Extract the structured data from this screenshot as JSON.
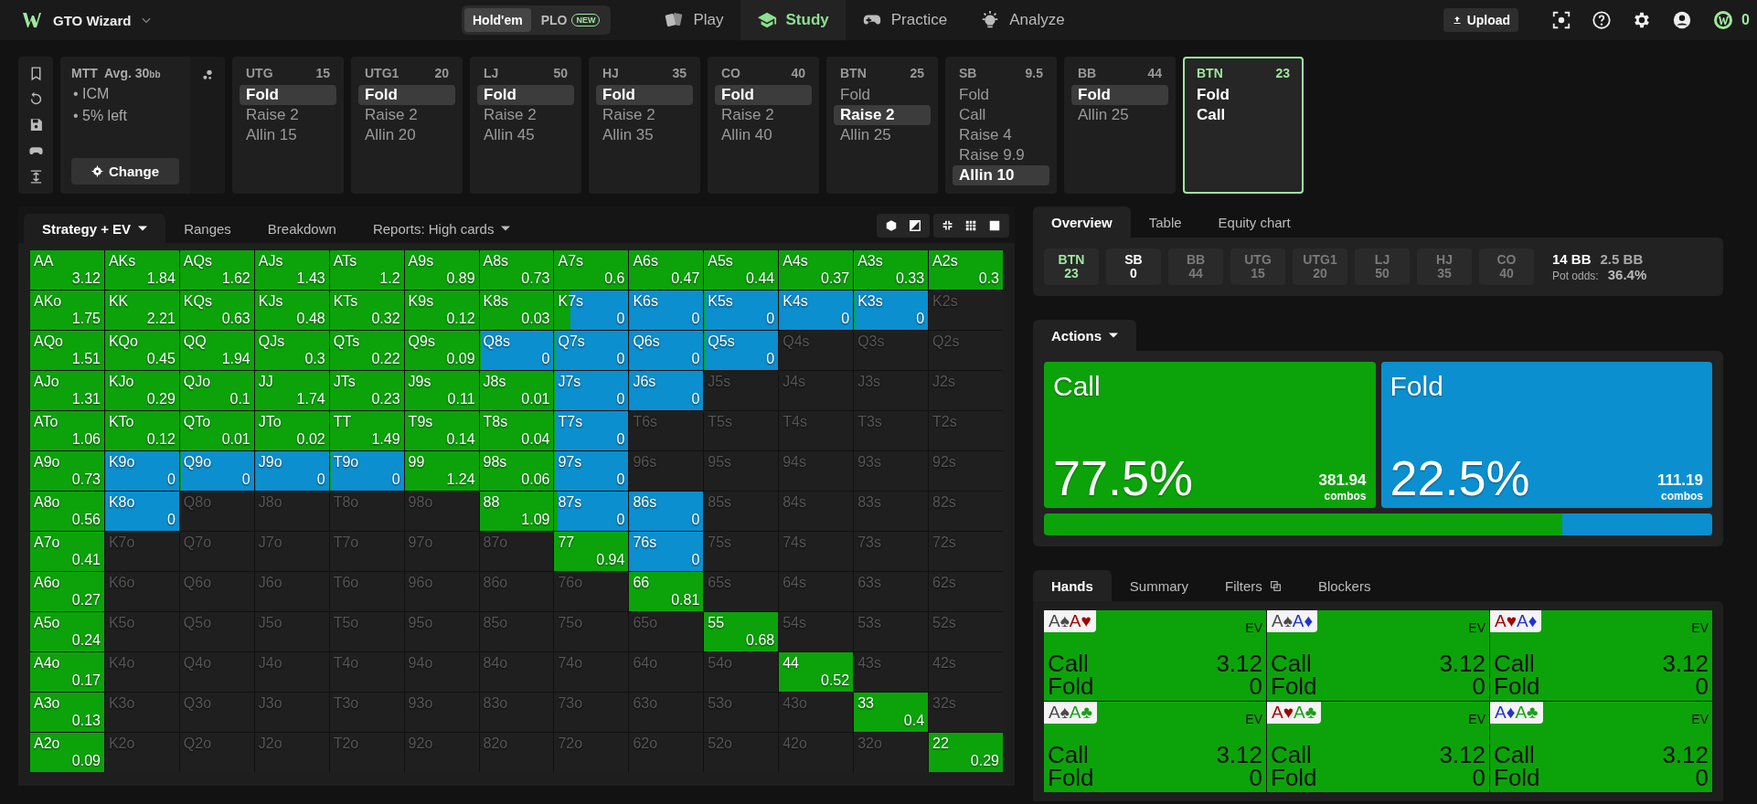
{
  "topbar": {
    "brand": "GTO Wizard",
    "game_toggle": [
      {
        "label": "Hold'em",
        "selected": true
      },
      {
        "label": "PLO",
        "badge": "NEW",
        "selected": false
      }
    ],
    "nav": [
      {
        "label": "Play",
        "selected": false
      },
      {
        "label": "Study",
        "selected": true
      },
      {
        "label": "Practice",
        "selected": false
      },
      {
        "label": "Analyze",
        "selected": false
      }
    ],
    "upload": "Upload",
    "coins": "0"
  },
  "spot": {
    "format": "MTT",
    "avg": "Avg. 30",
    "avg_unit": "bb",
    "notes": [
      "• ICM",
      "• 5% left"
    ],
    "change": "Change"
  },
  "positions": [
    {
      "position": "UTG",
      "stack": "15",
      "current": false,
      "actions": [
        {
          "label": "Fold",
          "selected": true
        },
        {
          "label": "Raise 2",
          "selected": false
        },
        {
          "label": "Allin 15",
          "selected": false
        }
      ]
    },
    {
      "position": "UTG1",
      "stack": "20",
      "current": false,
      "actions": [
        {
          "label": "Fold",
          "selected": true
        },
        {
          "label": "Raise 2",
          "selected": false
        },
        {
          "label": "Allin 20",
          "selected": false
        }
      ]
    },
    {
      "position": "LJ",
      "stack": "50",
      "current": false,
      "actions": [
        {
          "label": "Fold",
          "selected": true
        },
        {
          "label": "Raise 2",
          "selected": false
        },
        {
          "label": "Allin 45",
          "selected": false
        }
      ]
    },
    {
      "position": "HJ",
      "stack": "35",
      "current": false,
      "actions": [
        {
          "label": "Fold",
          "selected": true
        },
        {
          "label": "Raise 2",
          "selected": false
        },
        {
          "label": "Allin 35",
          "selected": false
        }
      ]
    },
    {
      "position": "CO",
      "stack": "40",
      "current": false,
      "actions": [
        {
          "label": "Fold",
          "selected": true
        },
        {
          "label": "Raise 2",
          "selected": false
        },
        {
          "label": "Allin 40",
          "selected": false
        }
      ]
    },
    {
      "position": "BTN",
      "stack": "25",
      "current": false,
      "actions": [
        {
          "label": "Fold",
          "selected": false
        },
        {
          "label": "Raise 2",
          "selected": true
        },
        {
          "label": "Allin 25",
          "selected": false
        }
      ]
    },
    {
      "position": "SB",
      "stack": "9.5",
      "current": false,
      "actions": [
        {
          "label": "Fold",
          "selected": false
        },
        {
          "label": "Call",
          "selected": false
        },
        {
          "label": "Raise 4",
          "selected": false
        },
        {
          "label": "Raise 9.9",
          "selected": false
        },
        {
          "label": "Allin 10",
          "selected": true
        }
      ]
    },
    {
      "position": "BB",
      "stack": "44",
      "current": false,
      "actions": [
        {
          "label": "Fold",
          "selected": true
        },
        {
          "label": "Allin 25",
          "selected": false
        }
      ]
    },
    {
      "position": "BTN",
      "stack": "23",
      "current": true,
      "actions": [
        {
          "label": "Fold",
          "selected": false
        },
        {
          "label": "Call",
          "selected": false
        }
      ]
    }
  ],
  "matrix_tabs": [
    {
      "label": "Strategy + EV",
      "selected": true,
      "dropdown": true
    },
    {
      "label": "Ranges",
      "selected": false,
      "dropdown": false
    },
    {
      "label": "Breakdown",
      "selected": false,
      "dropdown": false
    },
    {
      "label": "Reports: High cards",
      "selected": false,
      "dropdown": true
    }
  ],
  "matrix": {
    "rows": [
      {
        "cells": [
          {
            "hand": "AA",
            "ev": "3.12",
            "call": {
              "level": 1
            }
          },
          {
            "hand": "AKs",
            "ev": "1.84",
            "call": {
              "level": 1
            }
          },
          {
            "hand": "AQs",
            "ev": "1.62",
            "call": {
              "level": 1
            }
          },
          {
            "hand": "AJs",
            "ev": "1.43",
            "call": {
              "level": 1
            }
          },
          {
            "hand": "ATs",
            "ev": "1.2",
            "call": {
              "level": 1
            }
          },
          {
            "hand": "A9s",
            "ev": "0.89",
            "call": {
              "level": 1
            }
          },
          {
            "hand": "A8s",
            "ev": "0.73",
            "call": {
              "level": 1
            }
          },
          {
            "hand": "A7s",
            "ev": "0.6",
            "call": {
              "level": 1
            }
          },
          {
            "hand": "A6s",
            "ev": "0.47",
            "call": {
              "level": 1
            }
          },
          {
            "hand": "A5s",
            "ev": "0.44",
            "call": {
              "level": 1
            }
          },
          {
            "hand": "A4s",
            "ev": "0.37",
            "call": {
              "level": 1
            }
          },
          {
            "hand": "A3s",
            "ev": "0.33",
            "call": {
              "level": 1
            }
          },
          {
            "hand": "A2s",
            "ev": "0.3",
            "call": {
              "level": 1
            }
          }
        ]
      },
      {
        "cells": [
          {
            "hand": "AKo",
            "ev": "1.75",
            "call": {
              "level": 1
            }
          },
          {
            "hand": "KK",
            "ev": "2.21",
            "call": {
              "level": 1
            }
          },
          {
            "hand": "KQs",
            "ev": "0.63",
            "call": {
              "level": 1
            }
          },
          {
            "hand": "KJs",
            "ev": "0.48",
            "call": {
              "level": 1
            }
          },
          {
            "hand": "KTs",
            "ev": "0.32",
            "call": {
              "level": 1
            }
          },
          {
            "hand": "K9s",
            "ev": "0.12",
            "call": {
              "level": 1
            }
          },
          {
            "hand": "K8s",
            "ev": "0.03",
            "call": {
              "level": 1
            }
          },
          {
            "hand": "K7s",
            "ev": "0",
            "call": {
              "level": 0.22
            }
          },
          {
            "hand": "K6s",
            "ev": "0",
            "call": {
              "level": 0
            }
          },
          {
            "hand": "K5s",
            "ev": "0",
            "call": {
              "level": 0
            }
          },
          {
            "hand": "K4s",
            "ev": "0",
            "call": {
              "level": 0
            }
          },
          {
            "hand": "K3s",
            "ev": "0",
            "call": {
              "level": 0
            }
          },
          {
            "hand": "K2s"
          }
        ]
      },
      {
        "cells": [
          {
            "hand": "AQo",
            "ev": "1.51",
            "call": {
              "level": 1
            }
          },
          {
            "hand": "KQo",
            "ev": "0.45",
            "call": {
              "level": 1
            }
          },
          {
            "hand": "QQ",
            "ev": "1.94",
            "call": {
              "level": 1
            }
          },
          {
            "hand": "QJs",
            "ev": "0.3",
            "call": {
              "level": 1
            }
          },
          {
            "hand": "QTs",
            "ev": "0.22",
            "call": {
              "level": 1
            }
          },
          {
            "hand": "Q9s",
            "ev": "0.09",
            "call": {
              "level": 1
            }
          },
          {
            "hand": "Q8s",
            "ev": "0",
            "call": {
              "level": 0
            }
          },
          {
            "hand": "Q7s",
            "ev": "0",
            "call": {
              "level": 0
            }
          },
          {
            "hand": "Q6s",
            "ev": "0",
            "call": {
              "level": 0
            }
          },
          {
            "hand": "Q5s",
            "ev": "0",
            "call": {
              "level": 0
            }
          },
          {
            "hand": "Q4s"
          },
          {
            "hand": "Q3s"
          },
          {
            "hand": "Q2s"
          }
        ]
      },
      {
        "cells": [
          {
            "hand": "AJo",
            "ev": "1.31",
            "call": {
              "level": 1
            }
          },
          {
            "hand": "KJo",
            "ev": "0.29",
            "call": {
              "level": 1
            }
          },
          {
            "hand": "QJo",
            "ev": "0.1",
            "call": {
              "level": 1
            }
          },
          {
            "hand": "JJ",
            "ev": "1.74",
            "call": {
              "level": 1
            }
          },
          {
            "hand": "JTs",
            "ev": "0.23",
            "call": {
              "level": 1
            }
          },
          {
            "hand": "J9s",
            "ev": "0.11",
            "call": {
              "level": 1
            }
          },
          {
            "hand": "J8s",
            "ev": "0.01",
            "call": {
              "level": 1
            }
          },
          {
            "hand": "J7s",
            "ev": "0",
            "call": {
              "level": 0
            }
          },
          {
            "hand": "J6s",
            "ev": "0",
            "call": {
              "level": 0
            }
          },
          {
            "hand": "J5s"
          },
          {
            "hand": "J4s"
          },
          {
            "hand": "J3s"
          },
          {
            "hand": "J2s"
          }
        ]
      },
      {
        "cells": [
          {
            "hand": "ATo",
            "ev": "1.06",
            "call": {
              "level": 1
            }
          },
          {
            "hand": "KTo",
            "ev": "0.12",
            "call": {
              "level": 1
            }
          },
          {
            "hand": "QTo",
            "ev": "0.01",
            "call": {
              "level": 1
            }
          },
          {
            "hand": "JTo",
            "ev": "0.02",
            "call": {
              "level": 1
            }
          },
          {
            "hand": "TT",
            "ev": "1.49",
            "call": {
              "level": 1
            }
          },
          {
            "hand": "T9s",
            "ev": "0.14",
            "call": {
              "level": 1
            }
          },
          {
            "hand": "T8s",
            "ev": "0.04",
            "call": {
              "level": 1
            }
          },
          {
            "hand": "T7s",
            "ev": "0",
            "call": {
              "level": 0
            }
          },
          {
            "hand": "T6s"
          },
          {
            "hand": "T5s"
          },
          {
            "hand": "T4s"
          },
          {
            "hand": "T3s"
          },
          {
            "hand": "T2s"
          }
        ]
      },
      {
        "cells": [
          {
            "hand": "A9o",
            "ev": "0.73",
            "call": {
              "level": 1
            }
          },
          {
            "hand": "K9o",
            "ev": "0",
            "call": {
              "level": 0
            }
          },
          {
            "hand": "Q9o",
            "ev": "0",
            "call": {
              "level": 0
            }
          },
          {
            "hand": "J9o",
            "ev": "0",
            "call": {
              "level": 0
            }
          },
          {
            "hand": "T9o",
            "ev": "0",
            "call": {
              "level": 0
            }
          },
          {
            "hand": "99",
            "ev": "1.24",
            "call": {
              "level": 1
            }
          },
          {
            "hand": "98s",
            "ev": "0.06",
            "call": {
              "level": 1
            }
          },
          {
            "hand": "97s",
            "ev": "0",
            "call": {
              "level": 0
            }
          },
          {
            "hand": "96s"
          },
          {
            "hand": "95s"
          },
          {
            "hand": "94s"
          },
          {
            "hand": "93s"
          },
          {
            "hand": "92s"
          }
        ]
      },
      {
        "cells": [
          {
            "hand": "A8o",
            "ev": "0.56",
            "call": {
              "level": 1
            }
          },
          {
            "hand": "K8o",
            "ev": "0",
            "call": {
              "level": 0
            }
          },
          {
            "hand": "Q8o"
          },
          {
            "hand": "J8o"
          },
          {
            "hand": "T8o"
          },
          {
            "hand": "98o"
          },
          {
            "hand": "88",
            "ev": "1.09",
            "call": {
              "level": 1
            }
          },
          {
            "hand": "87s",
            "ev": "0",
            "call": {
              "level": 0.05
            }
          },
          {
            "hand": "86s",
            "ev": "0",
            "call": {
              "level": 0
            }
          },
          {
            "hand": "85s"
          },
          {
            "hand": "84s"
          },
          {
            "hand": "83s"
          },
          {
            "hand": "82s"
          }
        ]
      },
      {
        "cells": [
          {
            "hand": "A7o",
            "ev": "0.41",
            "call": {
              "level": 1
            }
          },
          {
            "hand": "K7o"
          },
          {
            "hand": "Q7o"
          },
          {
            "hand": "J7o"
          },
          {
            "hand": "T7o"
          },
          {
            "hand": "97o"
          },
          {
            "hand": "87o"
          },
          {
            "hand": "77",
            "ev": "0.94",
            "call": {
              "level": 1
            }
          },
          {
            "hand": "76s",
            "ev": "0",
            "call": {
              "level": 0
            }
          },
          {
            "hand": "75s"
          },
          {
            "hand": "74s"
          },
          {
            "hand": "73s"
          },
          {
            "hand": "72s"
          }
        ]
      },
      {
        "cells": [
          {
            "hand": "A6o",
            "ev": "0.27",
            "call": {
              "level": 1
            }
          },
          {
            "hand": "K6o"
          },
          {
            "hand": "Q6o"
          },
          {
            "hand": "J6o"
          },
          {
            "hand": "T6o"
          },
          {
            "hand": "96o"
          },
          {
            "hand": "86o"
          },
          {
            "hand": "76o"
          },
          {
            "hand": "66",
            "ev": "0.81",
            "call": {
              "level": 1
            }
          },
          {
            "hand": "65s"
          },
          {
            "hand": "64s"
          },
          {
            "hand": "63s"
          },
          {
            "hand": "62s"
          }
        ]
      },
      {
        "cells": [
          {
            "hand": "A5o",
            "ev": "0.24",
            "call": {
              "level": 1
            }
          },
          {
            "hand": "K5o"
          },
          {
            "hand": "Q5o"
          },
          {
            "hand": "J5o"
          },
          {
            "hand": "T5o"
          },
          {
            "hand": "95o"
          },
          {
            "hand": "85o"
          },
          {
            "hand": "75o"
          },
          {
            "hand": "65o"
          },
          {
            "hand": "55",
            "ev": "0.68",
            "call": {
              "level": 1
            }
          },
          {
            "hand": "54s"
          },
          {
            "hand": "53s"
          },
          {
            "hand": "52s"
          }
        ]
      },
      {
        "cells": [
          {
            "hand": "A4o",
            "ev": "0.17",
            "call": {
              "level": 1
            }
          },
          {
            "hand": "K4o"
          },
          {
            "hand": "Q4o"
          },
          {
            "hand": "J4o"
          },
          {
            "hand": "T4o"
          },
          {
            "hand": "94o"
          },
          {
            "hand": "84o"
          },
          {
            "hand": "74o"
          },
          {
            "hand": "64o"
          },
          {
            "hand": "54o"
          },
          {
            "hand": "44",
            "ev": "0.52",
            "call": {
              "level": 1
            }
          },
          {
            "hand": "43s"
          },
          {
            "hand": "42s"
          }
        ]
      },
      {
        "cells": [
          {
            "hand": "A3o",
            "ev": "0.13",
            "call": {
              "level": 1
            }
          },
          {
            "hand": "K3o"
          },
          {
            "hand": "Q3o"
          },
          {
            "hand": "J3o"
          },
          {
            "hand": "T3o"
          },
          {
            "hand": "93o"
          },
          {
            "hand": "83o"
          },
          {
            "hand": "73o"
          },
          {
            "hand": "63o"
          },
          {
            "hand": "53o"
          },
          {
            "hand": "43o"
          },
          {
            "hand": "33",
            "ev": "0.4",
            "call": {
              "level": 1
            }
          },
          {
            "hand": "32s"
          }
        ]
      },
      {
        "cells": [
          {
            "hand": "A2o",
            "ev": "0.09",
            "call": {
              "level": 1
            }
          },
          {
            "hand": "K2o"
          },
          {
            "hand": "Q2o"
          },
          {
            "hand": "J2o"
          },
          {
            "hand": "T2o"
          },
          {
            "hand": "92o"
          },
          {
            "hand": "82o"
          },
          {
            "hand": "72o"
          },
          {
            "hand": "62o"
          },
          {
            "hand": "52o"
          },
          {
            "hand": "42o"
          },
          {
            "hand": "32o"
          },
          {
            "hand": "22",
            "ev": "0.29",
            "call": {
              "level": 1
            }
          }
        ]
      }
    ]
  },
  "overview_tabs": [
    {
      "label": "Overview",
      "selected": true
    },
    {
      "label": "Table",
      "selected": false
    },
    {
      "label": "Equity chart",
      "selected": false
    }
  ],
  "seats": [
    {
      "position": "BTN",
      "stack": "23",
      "kind": "hero"
    },
    {
      "position": "SB",
      "stack": "0",
      "kind": "live"
    },
    {
      "position": "BB",
      "stack": "44",
      "kind": "folded"
    },
    {
      "position": "UTG",
      "stack": "15",
      "kind": "folded"
    },
    {
      "position": "UTG1",
      "stack": "20",
      "kind": "folded"
    },
    {
      "position": "LJ",
      "stack": "50",
      "kind": "folded"
    },
    {
      "position": "HJ",
      "stack": "35",
      "kind": "folded"
    },
    {
      "position": "CO",
      "stack": "40",
      "kind": "folded"
    }
  ],
  "pot": {
    "pot": "14 BB",
    "to_call": "2.5 BB",
    "odds_label": "Pot odds:",
    "odds": "36.4%"
  },
  "actions_tab": {
    "label": "Actions",
    "dropdown": true
  },
  "actions": [
    {
      "name": "Call",
      "share": "77.5%",
      "combos": "381.94",
      "unit": "combos",
      "color": "#0ca30a",
      "level": 0.775
    },
    {
      "name": "Fold",
      "share": "22.5%",
      "combos": "111.19",
      "unit": "combos",
      "color": "#0b8fcf",
      "level": 0.225
    }
  ],
  "hands_tabs": [
    {
      "label": "Hands",
      "selected": true,
      "with_icon": false
    },
    {
      "label": "Summary",
      "selected": false,
      "with_icon": false
    },
    {
      "label": "Filters",
      "selected": false,
      "with_icon": true
    },
    {
      "label": "Blockers",
      "selected": false,
      "with_icon": false
    }
  ],
  "hands": [
    {
      "cards": [
        {
          "rank": "A",
          "suit": "♠",
          "color": "#4a4a4a"
        },
        {
          "rank": "A",
          "suit": "♥",
          "color": "#a00000"
        }
      ],
      "label": "EV",
      "lines": [
        {
          "action": "Call",
          "value": "3.12"
        },
        {
          "action": "Fold",
          "value": "0"
        }
      ]
    },
    {
      "cards": [
        {
          "rank": "A",
          "suit": "♠",
          "color": "#4a4a4a"
        },
        {
          "rank": "A",
          "suit": "♦",
          "color": "#2233cc"
        }
      ],
      "label": "EV",
      "lines": [
        {
          "action": "Call",
          "value": "3.12"
        },
        {
          "action": "Fold",
          "value": "0"
        }
      ]
    },
    {
      "cards": [
        {
          "rank": "A",
          "suit": "♥",
          "color": "#a00000"
        },
        {
          "rank": "A",
          "suit": "♦",
          "color": "#2233cc"
        }
      ],
      "label": "EV",
      "lines": [
        {
          "action": "Call",
          "value": "3.12"
        },
        {
          "action": "Fold",
          "value": "0"
        }
      ]
    },
    {
      "cards": [
        {
          "rank": "A",
          "suit": "♠",
          "color": "#4a4a4a"
        },
        {
          "rank": "A",
          "suit": "♣",
          "color": "#18a018"
        }
      ],
      "label": "EV",
      "lines": [
        {
          "action": "Call",
          "value": "3.12"
        },
        {
          "action": "Fold",
          "value": "0"
        }
      ]
    },
    {
      "cards": [
        {
          "rank": "A",
          "suit": "♥",
          "color": "#a00000"
        },
        {
          "rank": "A",
          "suit": "♣",
          "color": "#18a018"
        }
      ],
      "label": "EV",
      "lines": [
        {
          "action": "Call",
          "value": "3.12"
        },
        {
          "action": "Fold",
          "value": "0"
        }
      ]
    },
    {
      "cards": [
        {
          "rank": "A",
          "suit": "♦",
          "color": "#2233cc"
        },
        {
          "rank": "A",
          "suit": "♣",
          "color": "#18a018"
        }
      ],
      "label": "EV",
      "lines": [
        {
          "action": "Call",
          "value": "3.12"
        },
        {
          "action": "Fold",
          "value": "0"
        }
      ]
    }
  ]
}
